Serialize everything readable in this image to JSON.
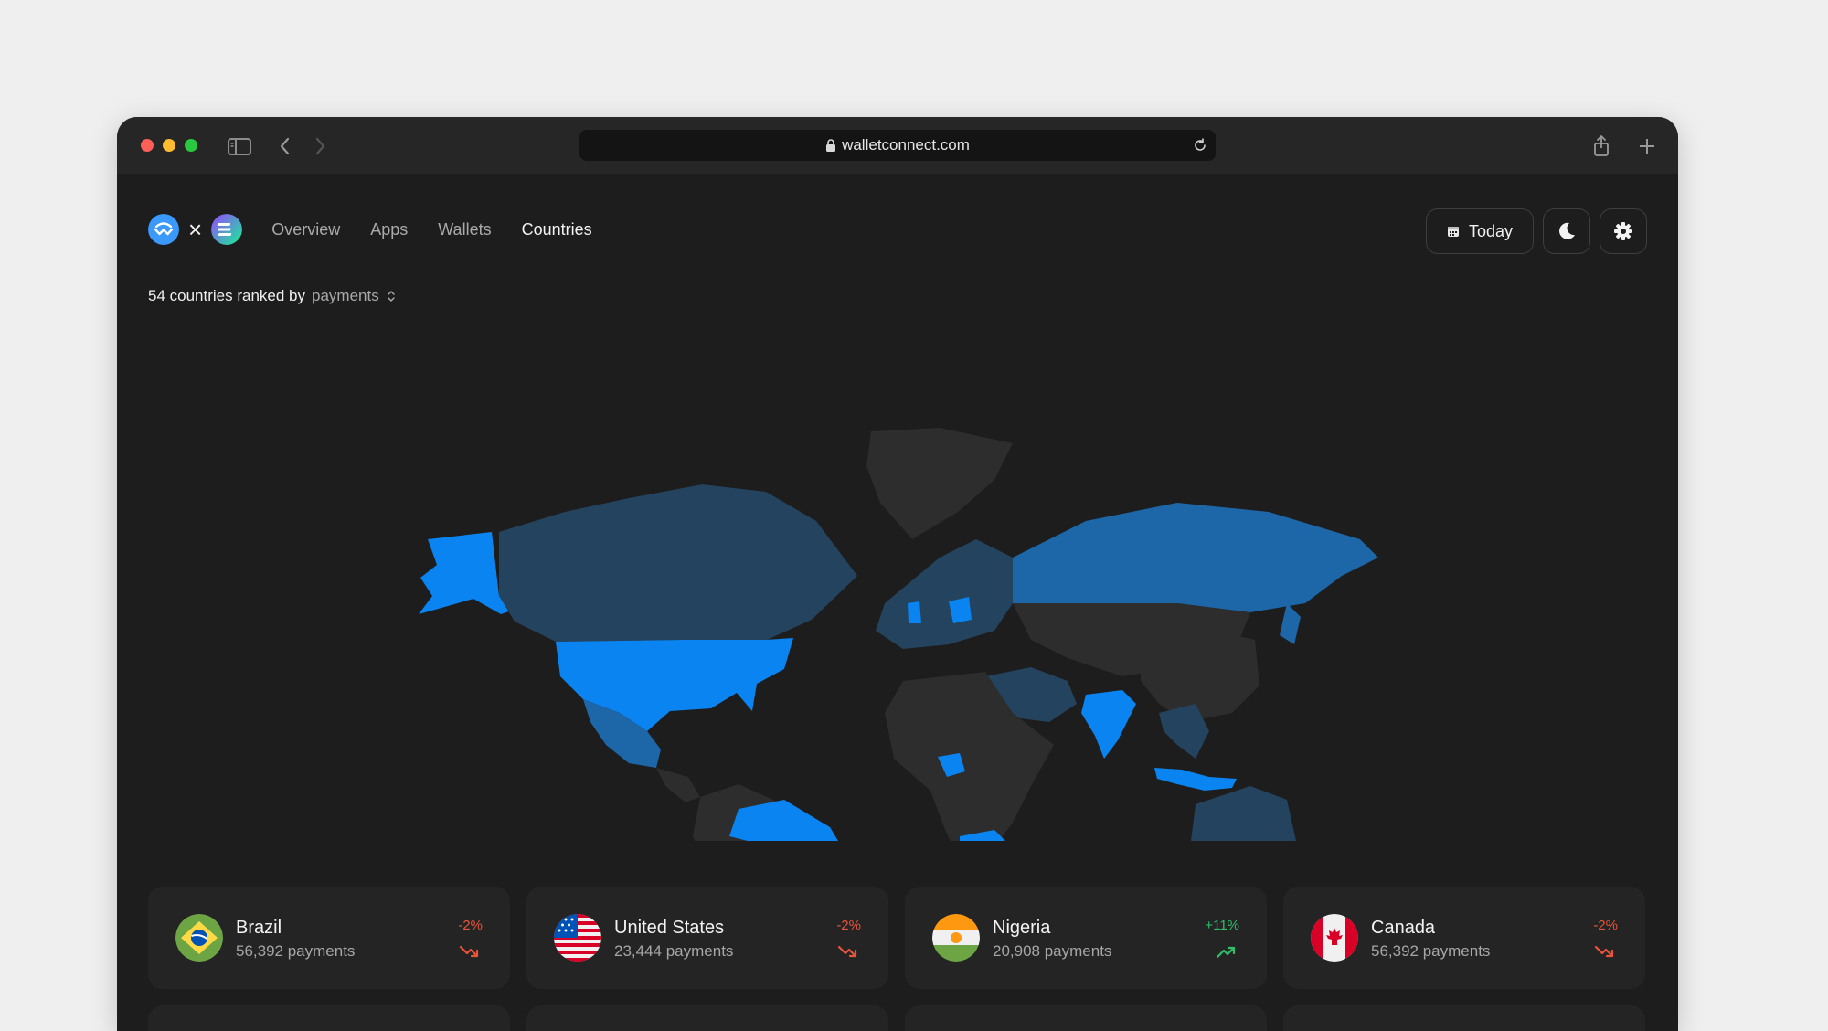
{
  "browser": {
    "url": "walletconnect.com"
  },
  "nav": {
    "items": [
      {
        "label": "Overview"
      },
      {
        "label": "Apps"
      },
      {
        "label": "Wallets"
      },
      {
        "label": "Countries"
      }
    ],
    "active": "Countries"
  },
  "toolbar": {
    "date_label": "Today"
  },
  "ranking": {
    "prefix": "54 countries ranked by",
    "metric": "payments"
  },
  "colors": {
    "highlight": "#0a84f0",
    "medium": "#1d66a8",
    "low": "#23435f",
    "none": "#2d2d2d",
    "down": "#e8543a",
    "up": "#2fbf6a"
  },
  "countries": [
    {
      "name": "Brazil",
      "payments": "56,392 payments",
      "change": "-2%",
      "trend": "down",
      "flag": "brazil-flag-icon"
    },
    {
      "name": "United States",
      "payments": "23,444 payments",
      "change": "-2%",
      "trend": "down",
      "flag": "us-flag-icon"
    },
    {
      "name": "Nigeria",
      "payments": "20,908 payments",
      "change": "+11%",
      "trend": "up",
      "flag": "niger-flag-icon"
    },
    {
      "name": "Canada",
      "payments": "56,392 payments",
      "change": "-2%",
      "trend": "down",
      "flag": "canada-flag-icon"
    }
  ]
}
